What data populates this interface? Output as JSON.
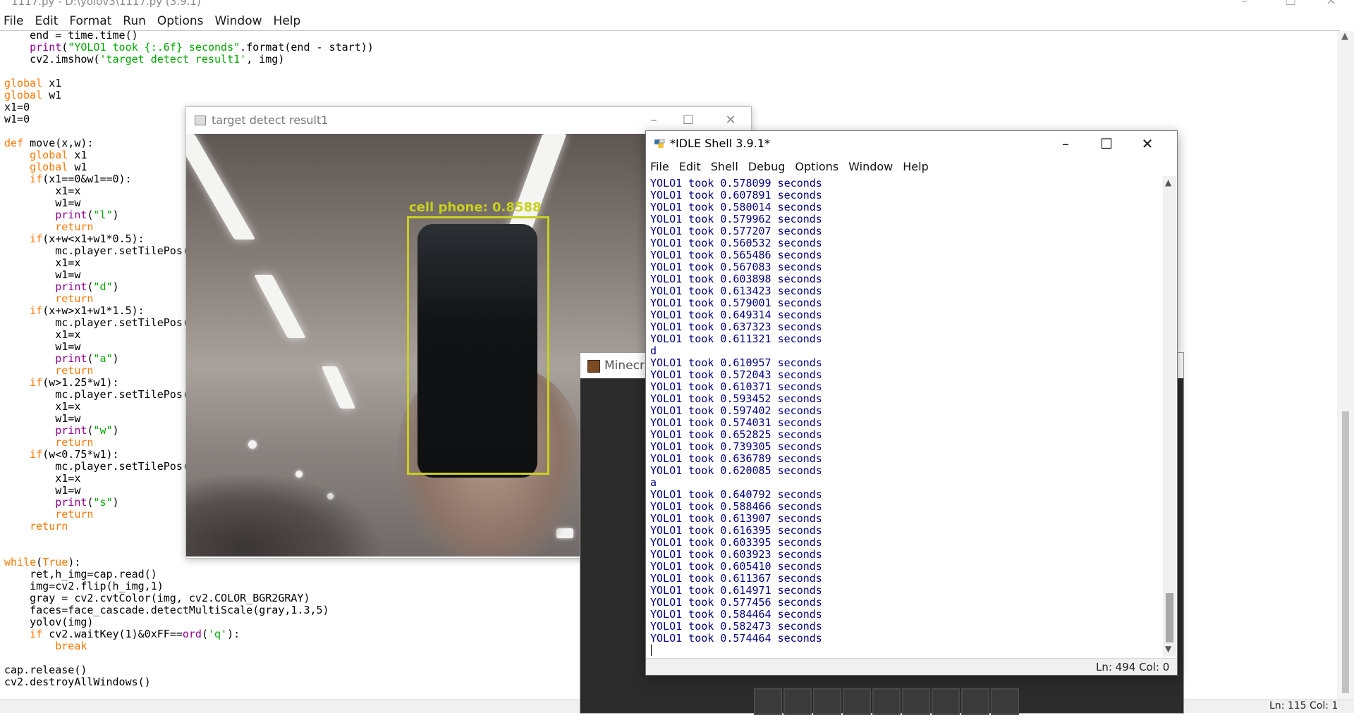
{
  "editor": {
    "title": "1117.py - D:\\yolov3\\1117.py (3.9.1)",
    "menu": [
      "File",
      "Edit",
      "Format",
      "Run",
      "Options",
      "Window",
      "Help"
    ],
    "code_lines": [
      "    end = time.time()",
      "    print(\"YOLO1 took {:.6f} seconds\".format(end - start))",
      "    cv2.imshow('target detect result1', img)",
      "",
      "global x1",
      "global w1",
      "x1=0",
      "w1=0",
      "",
      "def move(x,w):",
      "    global x1",
      "    global w1",
      "    if(x1==0&w1==0):",
      "        x1=x",
      "        w1=w",
      "        print(\"l\")",
      "        return",
      "    if(x+w<x1+w1*0.5):",
      "        mc.player.setTilePos(",
      "        x1=x",
      "        w1=w",
      "        print(\"d\")",
      "        return",
      "    if(x+w>x1+w1*1.5):",
      "        mc.player.setTilePos(",
      "        x1=x",
      "        w1=w",
      "        print(\"a\")",
      "        return",
      "    if(w>1.25*w1):",
      "        mc.player.setTilePos(",
      "        x1=x",
      "        w1=w",
      "        print(\"w\")",
      "        return",
      "    if(w<0.75*w1):",
      "        mc.player.setTilePos(",
      "        x1=x",
      "        w1=w",
      "        print(\"s\")",
      "        return",
      "    return",
      "",
      "",
      "while(True):",
      "    ret,h_img=cap.read()",
      "    img=cv2.flip(h_img,1)",
      "    gray = cv2.cvtColor(img, cv2.COLOR_BGR2GRAY)",
      "    faces=face_cascade.detectMultiScale(gray,1.3,5)",
      "    yolov(img)",
      "    if cv2.waitKey(1)&0xFF==ord('q'):",
      "        break",
      "",
      "cap.release()",
      "cv2.destroyAllWindows()"
    ],
    "status": "Ln: 115  Col: 1"
  },
  "cv_window": {
    "title": "target detect result1",
    "detection_label": "cell phone: 0.8588",
    "detection_confidence": 0.8588,
    "box_color": "#c8d11d"
  },
  "mc_window": {
    "title": "Minecraft"
  },
  "shell": {
    "title": "*IDLE Shell 3.9.1*",
    "menu": [
      "File",
      "Edit",
      "Shell",
      "Debug",
      "Options",
      "Window",
      "Help"
    ],
    "output_lines": [
      "YOLO1 took 0.578099 seconds",
      "YOLO1 took 0.607891 seconds",
      "YOLO1 took 0.580014 seconds",
      "YOLO1 took 0.579962 seconds",
      "YOLO1 took 0.577207 seconds",
      "YOLO1 took 0.560532 seconds",
      "YOLO1 took 0.565486 seconds",
      "YOLO1 took 0.567083 seconds",
      "YOLO1 took 0.603898 seconds",
      "YOLO1 took 0.613423 seconds",
      "YOLO1 took 0.579001 seconds",
      "YOLO1 took 0.649314 seconds",
      "YOLO1 took 0.637323 seconds",
      "YOLO1 took 0.611321 seconds",
      "d",
      "YOLO1 took 0.610957 seconds",
      "YOLO1 took 0.572043 seconds",
      "YOLO1 took 0.610371 seconds",
      "YOLO1 took 0.593452 seconds",
      "YOLO1 took 0.597402 seconds",
      "YOLO1 took 0.574031 seconds",
      "YOLO1 took 0.652825 seconds",
      "YOLO1 took 0.739305 seconds",
      "YOLO1 took 0.636789 seconds",
      "YOLO1 took 0.620085 seconds",
      "a",
      "YOLO1 took 0.640792 seconds",
      "YOLO1 took 0.588466 seconds",
      "YOLO1 took 0.613907 seconds",
      "YOLO1 took 0.616395 seconds",
      "YOLO1 took 0.603395 seconds",
      "YOLO1 took 0.603923 seconds",
      "YOLO1 took 0.605410 seconds",
      "YOLO1 took 0.611367 seconds",
      "YOLO1 took 0.614971 seconds",
      "YOLO1 took 0.577456 seconds",
      "YOLO1 took 0.584464 seconds",
      "YOLO1 took 0.582473 seconds",
      "YOLO1 took 0.574464 seconds"
    ],
    "status": "Ln: 494   Col: 0"
  },
  "icons": {
    "minimize": "–",
    "maximize": "☐",
    "close": "✕",
    "scroll_up": "▲",
    "scroll_down": "▼"
  },
  "colors": {
    "keyword": "#ff7700",
    "builtin": "#900090",
    "string": "#00aa00",
    "shell_output": "#000080"
  }
}
